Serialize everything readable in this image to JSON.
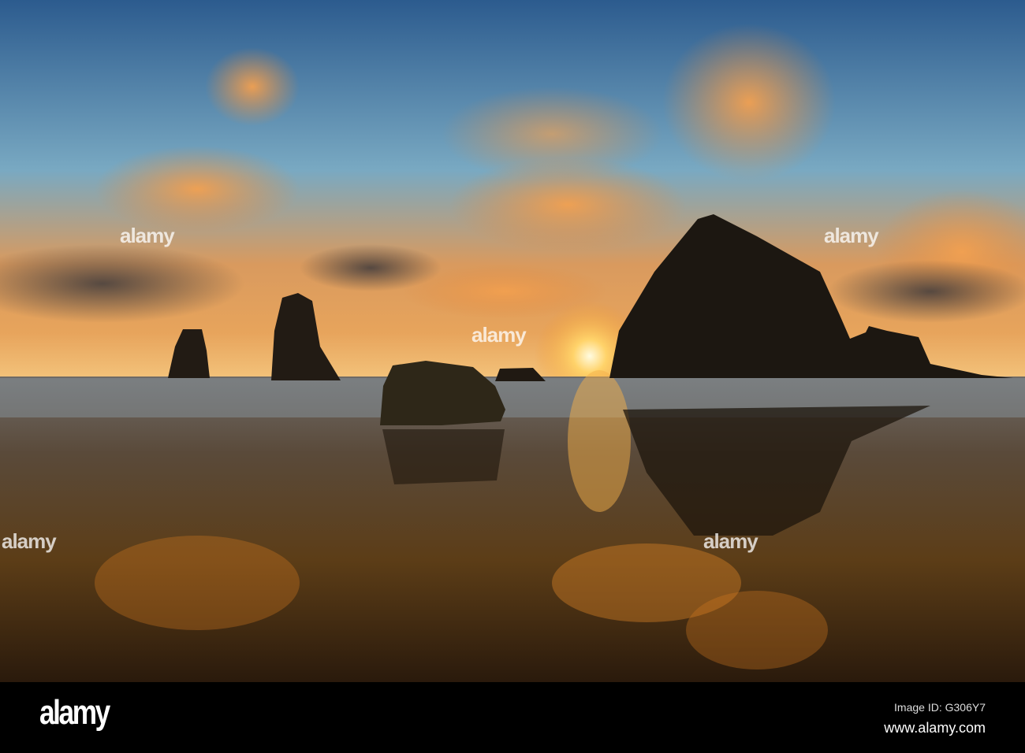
{
  "photo": {
    "subject": "Sunset at Haystack Rock beach",
    "colors": {
      "sky_top": "#2f5f93",
      "sky_mid": "#7fb0c8",
      "glow": "#f6a64a",
      "sun": "#fff3b0",
      "rock": "#1c1711",
      "sand": "#4a3418"
    }
  },
  "watermark": {
    "text": "alamy"
  },
  "footer": {
    "logo": "alamy",
    "image_id": "Image ID: G306Y7",
    "url": "www.alamy.com"
  }
}
